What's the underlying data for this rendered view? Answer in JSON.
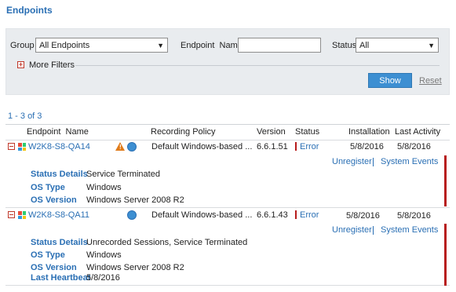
{
  "page": {
    "title": "Endpoints"
  },
  "filters": {
    "group_label": "Group",
    "group_value": "All Endpoints",
    "endpoint_name_label": "Endpoint  Name",
    "endpoint_name_value": "",
    "status_label": "Status",
    "status_value": "All",
    "more_filters_label": "More Filters",
    "show_label": "Show",
    "reset_label": "Reset"
  },
  "results": {
    "count_text": "1 - 3 of 3"
  },
  "table": {
    "columns": [
      "Endpoint  Name",
      "Recording Policy",
      "Version",
      "Status",
      "Installation",
      "Last Activity"
    ]
  },
  "rows": [
    {
      "name": "W2K8-S8-QA14",
      "policy": "Default Windows-based ...",
      "version": "6.6.1.51",
      "status": "Error",
      "installation": "5/8/2016",
      "last_activity": "5/8/2016",
      "unregister_label": "Unregister",
      "system_events_label": "System Events",
      "details": [
        {
          "label": "Status Details",
          "value": "Service Terminated"
        },
        {
          "label": "OS Type",
          "value": "Windows"
        },
        {
          "label": "OS Version",
          "value": "Windows Server 2008 R2"
        }
      ]
    },
    {
      "name": "W2K8-S8-QA11",
      "policy": "Default Windows-based ...",
      "version": "6.6.1.43",
      "status": "Error",
      "installation": "5/8/2016",
      "last_activity": "5/8/2016",
      "unregister_label": "Unregister",
      "system_events_label": "System Events",
      "details": [
        {
          "label": "Status Details",
          "value": "Unrecorded Sessions, Service Terminated"
        },
        {
          "label": "OS Type",
          "value": "Windows"
        },
        {
          "label": "OS Version",
          "value": "Windows Server 2008 R2"
        },
        {
          "label": "Last Heartbeat",
          "value": "5/8/2016"
        }
      ]
    }
  ],
  "colors": {
    "accent": "#2a6fb4",
    "error": "#b71c1c",
    "button": "#3d8fd2",
    "warning": "#e07b1a"
  },
  "icons": {
    "collapse": "collapse-minus-icon",
    "os": "windows-icon",
    "warning": "warning-icon",
    "globe": "globe-icon",
    "expand": "expand-plus-icon"
  }
}
